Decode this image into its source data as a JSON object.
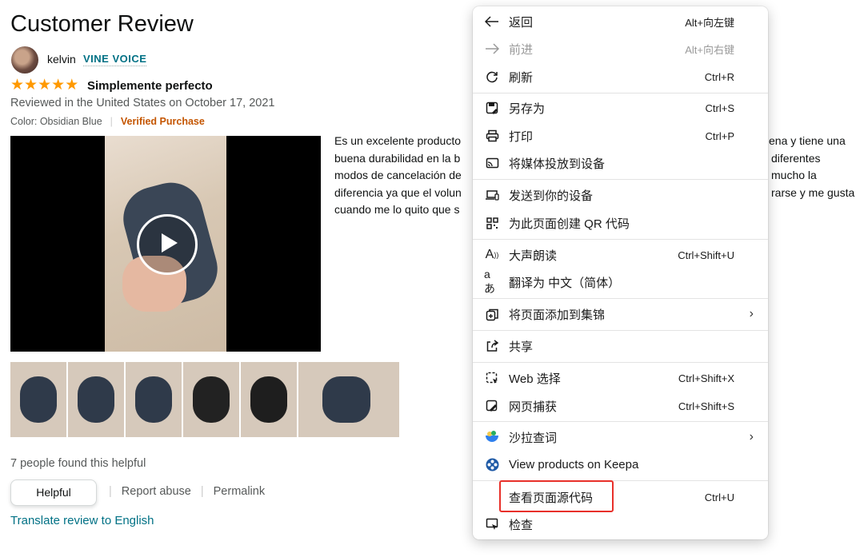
{
  "review": {
    "heading": "Customer Review",
    "user": "kelvin",
    "badge": "VINE VOICE",
    "stars": [
      "★",
      "★",
      "★",
      "★",
      "★"
    ],
    "rating": 5,
    "title": "Simplemente perfecto",
    "reviewed": "Reviewed in the United States on October 17, 2021",
    "color": "Color: Obsidian Blue",
    "verified": "Verified Purchase",
    "body": "Es un excelente producto ... ena y tiene una buena durabilidad en la b ... diferentes modos de cancelación de ... mucho la diferencia ya que el volun ... rarse y me gusta cuando me lo quito que s",
    "body_lines": [
      " Es un excelente producto",
      "buena durabilidad en la b",
      "modos de cancelación de",
      "diferencia ya que el volun",
      "cuando me lo quito que s"
    ],
    "body_lines_right": [
      "ena y tiene una",
      "diferentes",
      "mucho la",
      "rarse y me gusta"
    ],
    "helpful_count": "7 people found this helpful",
    "helpful_btn": "Helpful",
    "report": "Report abuse",
    "permalink": "Permalink",
    "translate": "Translate review to English"
  },
  "menu": {
    "items": [
      {
        "icon": "back-arrow-icon",
        "label": "返回",
        "shortcut": "Alt+向左键"
      },
      {
        "icon": "forward-arrow-icon",
        "label": "前进",
        "shortcut": "Alt+向右键",
        "disabled": true
      },
      {
        "icon": "refresh-icon",
        "label": "刷新",
        "shortcut": "Ctrl+R"
      },
      {
        "icon": "save-as-icon",
        "label": "另存为",
        "shortcut": "Ctrl+S"
      },
      {
        "icon": "print-icon",
        "label": "打印",
        "shortcut": "Ctrl+P"
      },
      {
        "icon": "cast-icon",
        "label": "将媒体投放到设备",
        "shortcut": ""
      },
      {
        "icon": "send-device-icon",
        "label": "发送到你的设备",
        "shortcut": ""
      },
      {
        "icon": "qr-code-icon",
        "label": "为此页面创建 QR 代码",
        "shortcut": ""
      },
      {
        "icon": "read-aloud-icon",
        "label": "大声朗读",
        "shortcut": "Ctrl+Shift+U"
      },
      {
        "icon": "translate-icon",
        "label": "翻译为 中文（简体）",
        "shortcut": ""
      },
      {
        "icon": "collections-icon",
        "label": "将页面添加到集锦",
        "shortcut": "",
        "submenu": true
      },
      {
        "icon": "share-icon",
        "label": "共享",
        "shortcut": ""
      },
      {
        "icon": "web-select-icon",
        "label": "Web 选择",
        "shortcut": "Ctrl+Shift+X"
      },
      {
        "icon": "web-capture-icon",
        "label": "网页捕获",
        "shortcut": "Ctrl+Shift+S"
      },
      {
        "icon": "salad-icon",
        "label": "沙拉查词",
        "shortcut": "",
        "submenu": true
      },
      {
        "icon": "keepa-icon",
        "label": "View products on Keepa",
        "shortcut": ""
      },
      {
        "icon": "",
        "label": "查看页面源代码",
        "shortcut": "Ctrl+U"
      },
      {
        "icon": "inspect-icon",
        "label": "检查",
        "shortcut": ""
      }
    ],
    "submenu_arrow": "›"
  },
  "colors": {
    "link": "#007185",
    "star": "#ff9900",
    "verified": "#c45500",
    "highlight": "#e8302a"
  }
}
